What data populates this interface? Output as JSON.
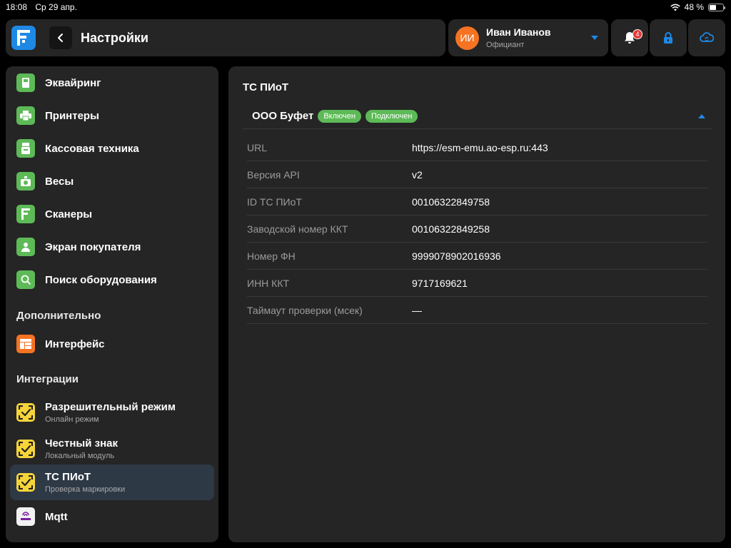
{
  "status_bar": {
    "time": "18:08",
    "date": "Ср 29 апр.",
    "battery": "48 %",
    "battery_level": 0.48
  },
  "header": {
    "title": "Настройки"
  },
  "user": {
    "initials": "ИИ",
    "name": "Иван Иванов",
    "role": "Официант"
  },
  "notifications": {
    "count": "4"
  },
  "sidebar": {
    "items": [
      {
        "label": "Эквайринг",
        "icon": "terminal-icon"
      },
      {
        "label": "Принтеры",
        "icon": "printer-icon"
      },
      {
        "label": "Кассовая техника",
        "icon": "cash-register-icon"
      },
      {
        "label": "Весы",
        "icon": "scales-icon"
      },
      {
        "label": "Сканеры",
        "icon": "scanner-icon"
      },
      {
        "label": "Экран покупателя",
        "icon": "customer-screen-icon"
      },
      {
        "label": "Поиск оборудования",
        "icon": "search-icon"
      }
    ],
    "section_additional": "Дополнительно",
    "interface": {
      "label": "Интерфейс",
      "icon": "layout-icon"
    },
    "section_integrations": "Интеграции",
    "integrations": [
      {
        "label": "Разрешительный режим",
        "sub": "Онлайн режим",
        "icon": "marking-icon"
      },
      {
        "label": "Честный знак",
        "sub": "Локальный модуль",
        "icon": "marking-icon"
      },
      {
        "label": "ТС ПИоТ",
        "sub": "Проверка маркировки",
        "icon": "marking-icon"
      }
    ],
    "mqtt": {
      "label": "Mqtt",
      "icon": "mqtt-icon"
    }
  },
  "main": {
    "title": "ТС ПИоТ",
    "org": {
      "name": "ООО Буфет",
      "badge_enabled": "Включен",
      "badge_connected": "Подключен"
    },
    "details": [
      {
        "label": "URL",
        "value": "https://esm-emu.ao-esp.ru:443"
      },
      {
        "label": "Версия API",
        "value": "v2"
      },
      {
        "label": "ID ТС ПИоТ",
        "value": "00106322849758"
      },
      {
        "label": "Заводской номер ККТ",
        "value": "00106322849258"
      },
      {
        "label": "Номер ФН",
        "value": "9999078902016936"
      },
      {
        "label": "ИНН ККТ",
        "value": "9717169621"
      },
      {
        "label": "Таймаут проверки (мсек)",
        "value": "—"
      }
    ]
  },
  "colors": {
    "accent": "#1e88e5",
    "success": "#5dba57",
    "orange": "#f57322",
    "yellow": "#f5d43a"
  }
}
